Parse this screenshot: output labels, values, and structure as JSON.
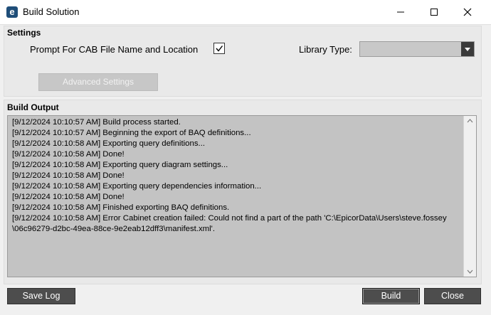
{
  "window": {
    "title": "Build Solution",
    "app_icon_glyph": "e",
    "controls": [
      "minimize-icon",
      "maximize-icon",
      "close-icon"
    ]
  },
  "settings": {
    "section_label": "Settings",
    "prompt_label": "Prompt For CAB File Name and Location",
    "prompt_checked": true,
    "library_type_label": "Library Type:",
    "library_type_value": "",
    "advanced_button": "Advanced Settings"
  },
  "output": {
    "section_label": "Build Output",
    "log_lines": [
      "[9/12/2024 10:10:57 AM] Build process started.",
      "[9/12/2024 10:10:57 AM] Beginning the export of BAQ definitions...",
      "[9/12/2024 10:10:58 AM] Exporting query definitions...",
      "[9/12/2024 10:10:58 AM] Done!",
      "[9/12/2024 10:10:58 AM] Exporting query diagram settings...",
      "[9/12/2024 10:10:58 AM] Done!",
      "[9/12/2024 10:10:58 AM] Exporting query dependencies information...",
      "[9/12/2024 10:10:58 AM] Done!",
      "[9/12/2024 10:10:58 AM] Finished exporting BAQ definitions.",
      "[9/12/2024 10:10:58 AM] Error Cabinet creation failed: Could not find a part of the path 'C:\\EpicorData\\Users\\steve.fossey",
      "\\06c96279-d2bc-49ea-88ce-9e2eab12dff3\\manifest.xml'."
    ]
  },
  "buttons": {
    "save_log": "Save Log",
    "build": "Build",
    "close": "Close"
  },
  "colors": {
    "button_bg": "#4d4d4d",
    "log_bg": "#c3c3c3",
    "panel_bg": "#e9e9e9",
    "app_icon": "#1f4e79"
  }
}
